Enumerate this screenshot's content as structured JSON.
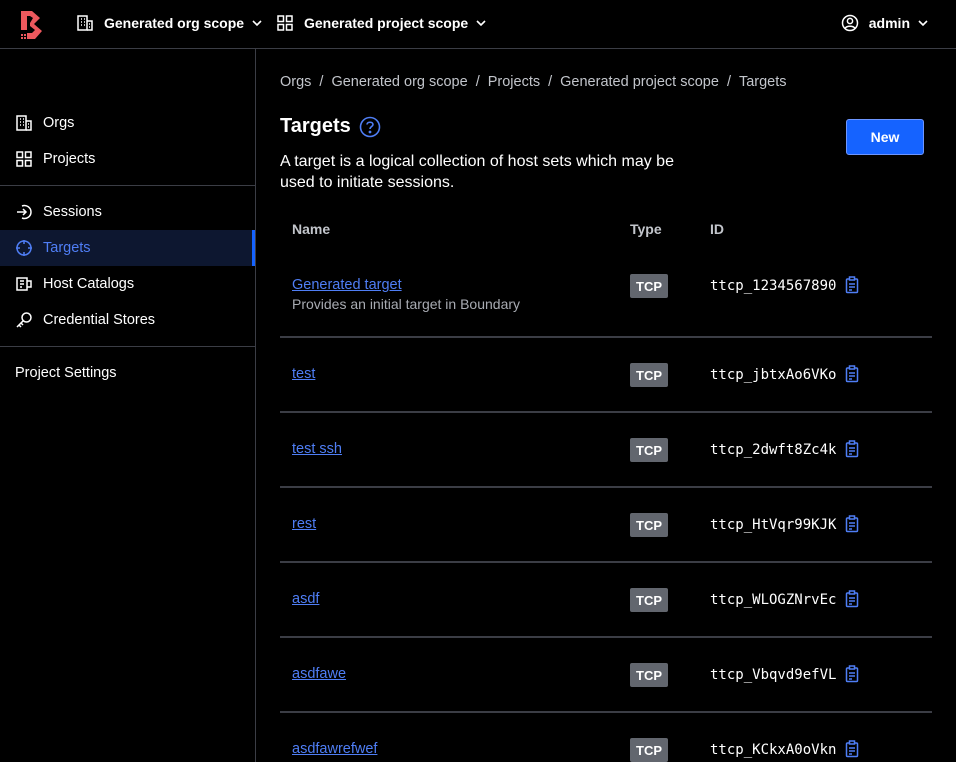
{
  "topbar": {
    "org_scope": "Generated org scope",
    "project_scope": "Generated project scope",
    "user": "admin"
  },
  "sidebar": {
    "items": [
      {
        "label": "Orgs",
        "icon": "org-icon"
      },
      {
        "label": "Projects",
        "icon": "grid-icon"
      },
      {
        "label": "Sessions",
        "icon": "sessions-icon"
      },
      {
        "label": "Targets",
        "icon": "target-icon",
        "active": true
      },
      {
        "label": "Host Catalogs",
        "icon": "host-catalog-icon"
      },
      {
        "label": "Credential Stores",
        "icon": "key-icon"
      },
      {
        "label": "Project Settings"
      }
    ]
  },
  "breadcrumb": [
    "Orgs",
    "Generated org scope",
    "Projects",
    "Generated project scope",
    "Targets"
  ],
  "page": {
    "title": "Targets",
    "description": "A target is a logical collection of host sets which may be used to initiate sessions.",
    "new_label": "New"
  },
  "table": {
    "headers": {
      "name": "Name",
      "type": "Type",
      "id": "ID"
    },
    "rows": [
      {
        "name": "Generated target",
        "description": "Provides an initial target in Boundary",
        "type": "TCP",
        "id": "ttcp_1234567890"
      },
      {
        "name": "test",
        "type": "TCP",
        "id": "ttcp_jbtxAo6VKo"
      },
      {
        "name": "test ssh",
        "type": "TCP",
        "id": "ttcp_2dwft8Zc4k"
      },
      {
        "name": "rest",
        "type": "TCP",
        "id": "ttcp_HtVqr99KJK"
      },
      {
        "name": "asdf",
        "type": "TCP",
        "id": "ttcp_WLOGZNrvEc"
      },
      {
        "name": "asdfawe",
        "type": "TCP",
        "id": "ttcp_Vbqvd9efVL"
      },
      {
        "name": "asdfawrefwef",
        "type": "TCP",
        "id": "ttcp_KCkxA0oVkn"
      }
    ]
  },
  "colors": {
    "accent": "#1563ff",
    "link": "#4f7ef5",
    "logo": "#ec585d"
  }
}
